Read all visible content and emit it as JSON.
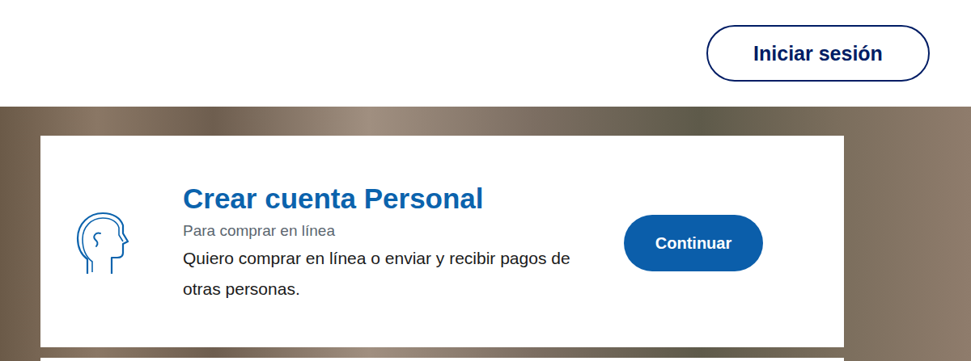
{
  "header": {
    "login_button": "Iniciar sesión"
  },
  "card": {
    "title": "Crear cuenta Personal",
    "subtitle": "Para comprar en línea",
    "description": "Quiero comprar en línea o enviar y recibir pagos de otras personas.",
    "button": "Continuar"
  }
}
